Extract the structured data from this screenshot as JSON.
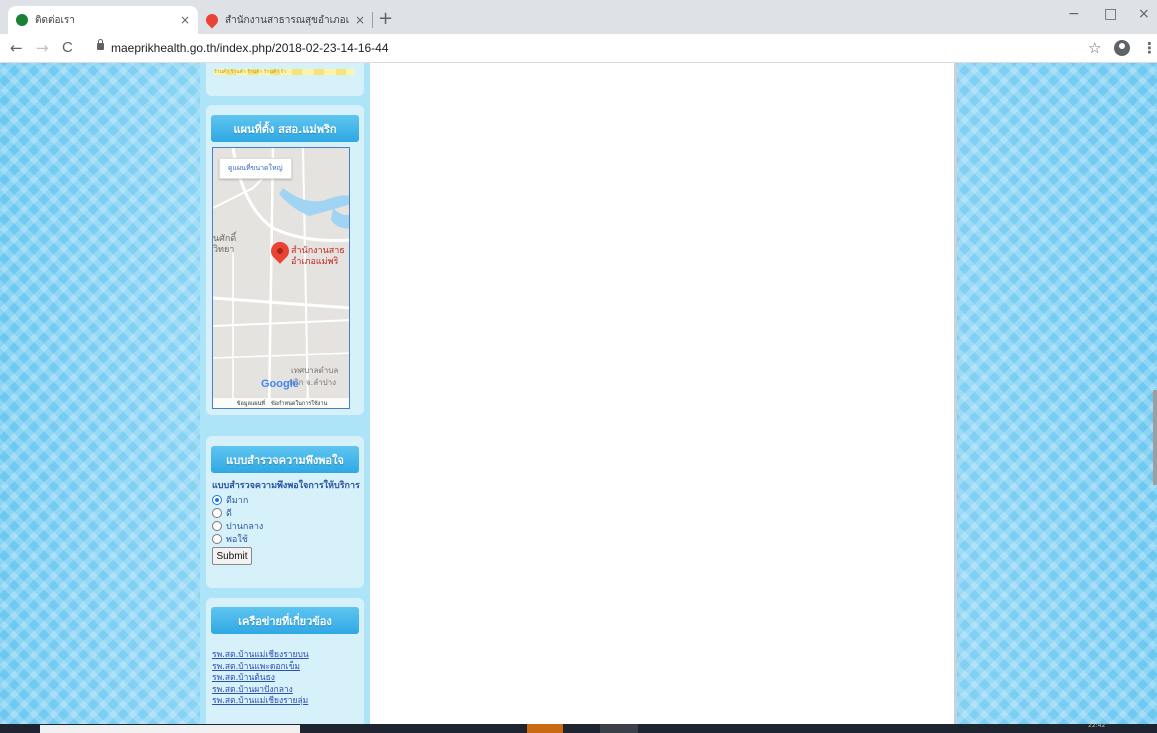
{
  "browser": {
    "tabs": [
      {
        "title": "ติดต่อเรา",
        "close": "×",
        "favicon_color": "#1a7f37"
      },
      {
        "title": "สำนักงานสาธารณสุขอำเภอแม่พริก - Goo",
        "close": "×",
        "favicon_color": "#ea4335"
      }
    ],
    "new_tab": "+",
    "window_controls": {
      "minimize": "−",
      "maximize": "□",
      "close": "×"
    },
    "nav": {
      "back": "←",
      "forward": "→",
      "reload": "C"
    },
    "url": "maeprikhealth.go.th/index.php/2018-02-23-14-16-44",
    "bookmark": "☆",
    "menu": "⋮"
  },
  "sidebar": {
    "banner_strip_text": "ร้านค้า ร้านค้า ร้านค้า ร้านค้า ร้า",
    "map_section": {
      "title": "แผนที่ตั้ง สสอ.แม่พริก",
      "view_larger": "ดูแผนที่ขนาดใหญ่",
      "marker_label_line1": "สำนักงานสาธ",
      "marker_label_line2": "อำเภอแม่พริ",
      "area_label_1": "นศักดิ์",
      "area_label_2": "วิทยา",
      "area_label_3": "เทศบาลตำบล",
      "area_label_4": "พริก จ.ลำปาง",
      "google": "Google",
      "footer_data": "ข้อมูลแผนที่",
      "footer_terms": "ข้อกำหนดในการใช้งาน"
    },
    "poll": {
      "title": "แบบสำรวจความพึงพอใจ",
      "question": "แบบสำรวจความพึงพอใจการให้บริการ",
      "options": [
        "ดีมาก",
        "ดี",
        "ปานกลาง",
        "พอใช้"
      ],
      "selected": "ดีมาก",
      "submit": "Submit"
    },
    "network": {
      "title": "เครือข่ายที่เกี่ยวข้อง",
      "links": [
        "รพ.สต.บ้านแม่เชียงรายบน",
        "รพ.สต.บ้านแพะดอกเข็ม",
        "รพ.สต.บ้านต้นธง",
        "รพ.สต.บ้านผาปังกลาง",
        "รพ.สต.บ้านแม่เชียงรายลุ่ม"
      ]
    }
  },
  "taskbar": {
    "clock": "22:42"
  }
}
